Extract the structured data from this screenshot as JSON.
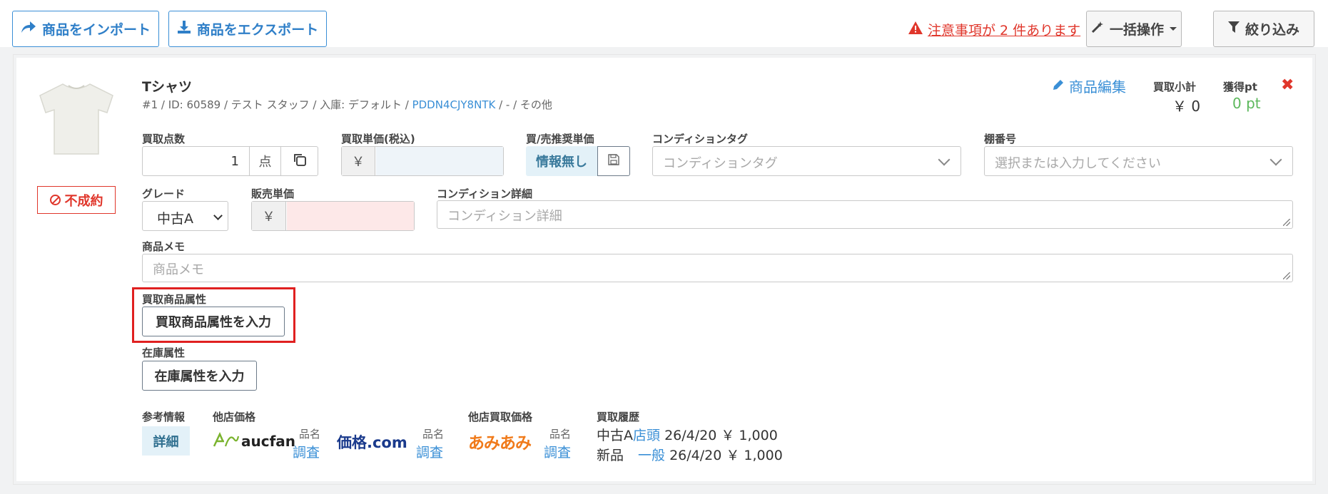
{
  "toolbar": {
    "import_label": "商品をインポート",
    "export_label": "商品をエクスポート",
    "notice_label": "注意事項が 2 件あります",
    "bulk_label": "一括操作",
    "filter_label": "絞り込み"
  },
  "item": {
    "name": "Tシャツ",
    "meta_prefix": "#1 / ID: 60589 / テスト スタッフ / 入庫: デフォルト / ",
    "meta_code": "PDDN4CJY8NTK",
    "meta_suffix": " / - / その他",
    "reject_label": "不成約",
    "edit_label": "商品編集",
    "subtotal_label": "買取小計",
    "subtotal_value": "￥ 0",
    "points_label": "獲得pt",
    "points_value": "0 pt"
  },
  "fields": {
    "qty_label": "買取点数",
    "qty_value": "1",
    "qty_unit": "点",
    "unit_price_label": "買取単価(税込)",
    "yen": "￥",
    "recommend_label": "買/売推奨単価",
    "recommend_value": "情報無し",
    "condition_tag_label": "コンディションタグ",
    "condition_tag_placeholder": "コンディションタグ",
    "shelf_label": "棚番号",
    "shelf_placeholder": "選択または入力してください",
    "grade_label": "グレード",
    "grade_value": "中古A",
    "sale_price_label": "販売単価",
    "condition_detail_label": "コンディション詳細",
    "condition_detail_placeholder": "コンディション詳細",
    "memo_label": "商品メモ",
    "memo_placeholder": "商品メモ",
    "buy_attr_label": "買取商品属性",
    "buy_attr_button": "買取商品属性を入力",
    "stock_attr_label": "在庫属性",
    "stock_attr_button": "在庫属性を入力"
  },
  "reference": {
    "ref_label": "参考情報",
    "detail_button": "詳細",
    "other_price_label": "他店価格",
    "aucfan_logo": "aucfan",
    "kakaku_logo": "価格.com",
    "hinmei": "品名",
    "chousa": "調査",
    "other_buy_label": "他店買取価格",
    "amiami_logo": "あみあみ",
    "history_label": "買取履歴",
    "history": [
      {
        "grade": "中古A",
        "type": "店頭",
        "date": "26/4/20",
        "price": "￥ 1,000"
      },
      {
        "grade": "新品",
        "type": "一般",
        "date": "26/4/20",
        "price": "￥ 1,000"
      }
    ]
  },
  "colors": {
    "accent": "#3a8fd6",
    "danger": "#e0362b",
    "points": "#5cb85c",
    "highlight_box": "#e02020"
  }
}
